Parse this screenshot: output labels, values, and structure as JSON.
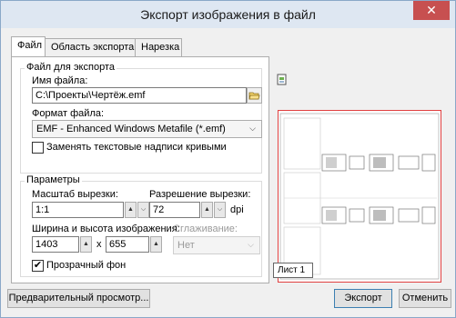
{
  "window": {
    "title": "Экспорт изображения в файл",
    "close_glyph": "✕"
  },
  "tabs": [
    {
      "label": "Файл",
      "active": true
    },
    {
      "label": "Область экспорта",
      "active": false
    },
    {
      "label": "Нарезка",
      "active": false
    }
  ],
  "file_group": {
    "legend": "Файл для экспорта",
    "filename_label": "Имя файла:",
    "filename_value": "C:\\Проекты\\Чертёж.emf",
    "format_label": "Формат файла:",
    "format_value": "EMF - Enhanced Windows Metafile (*.emf)",
    "replace_text_label": "Заменять текстовые надписи кривыми",
    "replace_text_checked": false
  },
  "params_group": {
    "legend": "Параметры",
    "scale_label": "Масштаб вырезки:",
    "scale_value": "1:1",
    "resolution_label": "Разрешение вырезки:",
    "resolution_value": "72",
    "resolution_unit": "dpi",
    "size_label": "Ширина и высота изображения:",
    "width_value": "1403",
    "times_glyph": "x",
    "height_value": "655",
    "smoothing_label": "Сглаживание:",
    "smoothing_value": "Нет",
    "transparent_label": "Прозрачный фон",
    "transparent_checked": true
  },
  "preview": {
    "sheet_label": "Лист 1"
  },
  "buttons": {
    "preview": "Предварительный просмотр...",
    "export": "Экспорт",
    "cancel": "Отменить"
  },
  "glyphs": {
    "check": "✔",
    "up": "▲",
    "down": "▼",
    "dropdown": "⌵"
  }
}
